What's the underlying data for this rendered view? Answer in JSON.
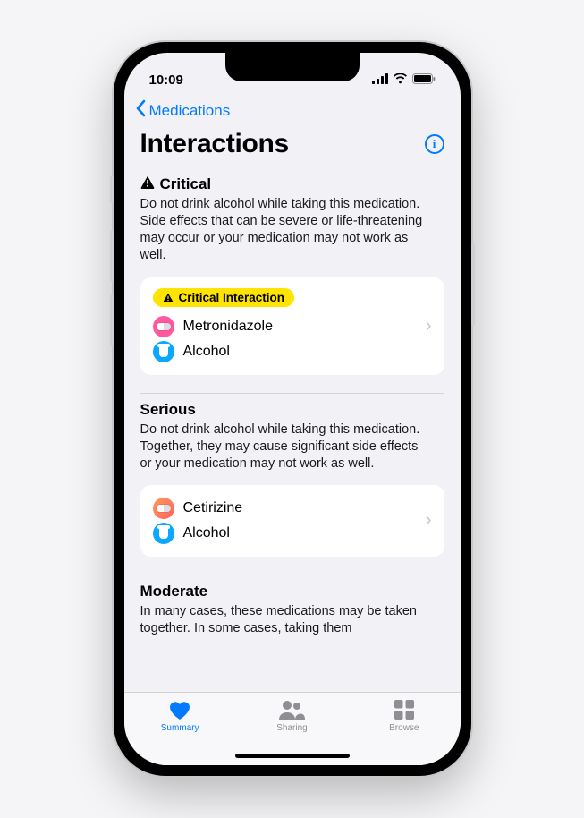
{
  "status": {
    "time": "10:09"
  },
  "nav": {
    "back_label": "Medications"
  },
  "title": "Interactions",
  "sections": [
    {
      "heading": "Critical",
      "show_warning_icon": true,
      "description": "Do not drink alcohol while taking this medication. Side effects that can be severe or life-threatening may occur or your medication may not work as well.",
      "card": {
        "badge": "Critical Interaction",
        "items": [
          {
            "name": "Metronidazole",
            "icon": "pill-pink"
          },
          {
            "name": "Alcohol",
            "icon": "glass-blue"
          }
        ]
      }
    },
    {
      "heading": "Serious",
      "show_warning_icon": false,
      "description": "Do not drink alcohol while taking this medication. Together, they may cause significant side effects or your medication may not work as well.",
      "card": {
        "badge": null,
        "items": [
          {
            "name": "Cetirizine",
            "icon": "pill-orange"
          },
          {
            "name": "Alcohol",
            "icon": "glass-blue"
          }
        ]
      }
    },
    {
      "heading": "Moderate",
      "show_warning_icon": false,
      "description": "In many cases, these medications may be taken together. In some cases, taking them"
    }
  ],
  "tabs": [
    {
      "label": "Summary",
      "active": true
    },
    {
      "label": "Sharing",
      "active": false
    },
    {
      "label": "Browse",
      "active": false
    }
  ]
}
